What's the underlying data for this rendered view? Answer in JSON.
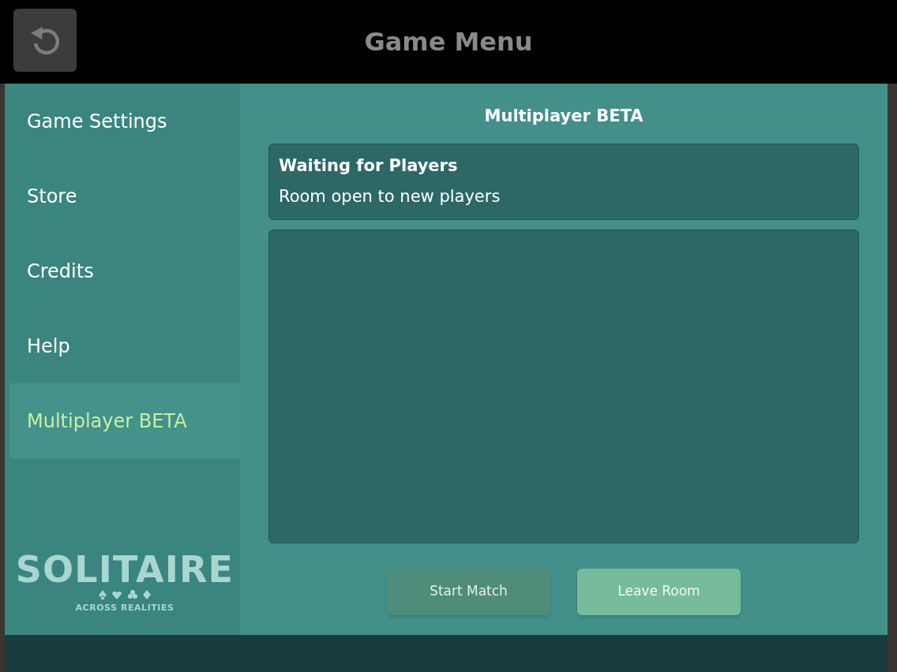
{
  "header": {
    "title": "Game Menu"
  },
  "sidebar": {
    "items": [
      {
        "label": "Game Settings",
        "selected": false
      },
      {
        "label": "Store",
        "selected": false
      },
      {
        "label": "Credits",
        "selected": false
      },
      {
        "label": "Help",
        "selected": false
      },
      {
        "label": "Multiplayer BETA",
        "selected": true
      }
    ],
    "logo": {
      "title": "SOLITAIRE",
      "subtitle": "ACROSS REALITIES"
    }
  },
  "content": {
    "title": "Multiplayer BETA",
    "status": {
      "heading": "Waiting for Players",
      "message": "Room open to new players"
    },
    "buttons": [
      {
        "label": "Start Match",
        "kind": "muted"
      },
      {
        "label": "Leave Room",
        "kind": "accent"
      }
    ]
  }
}
